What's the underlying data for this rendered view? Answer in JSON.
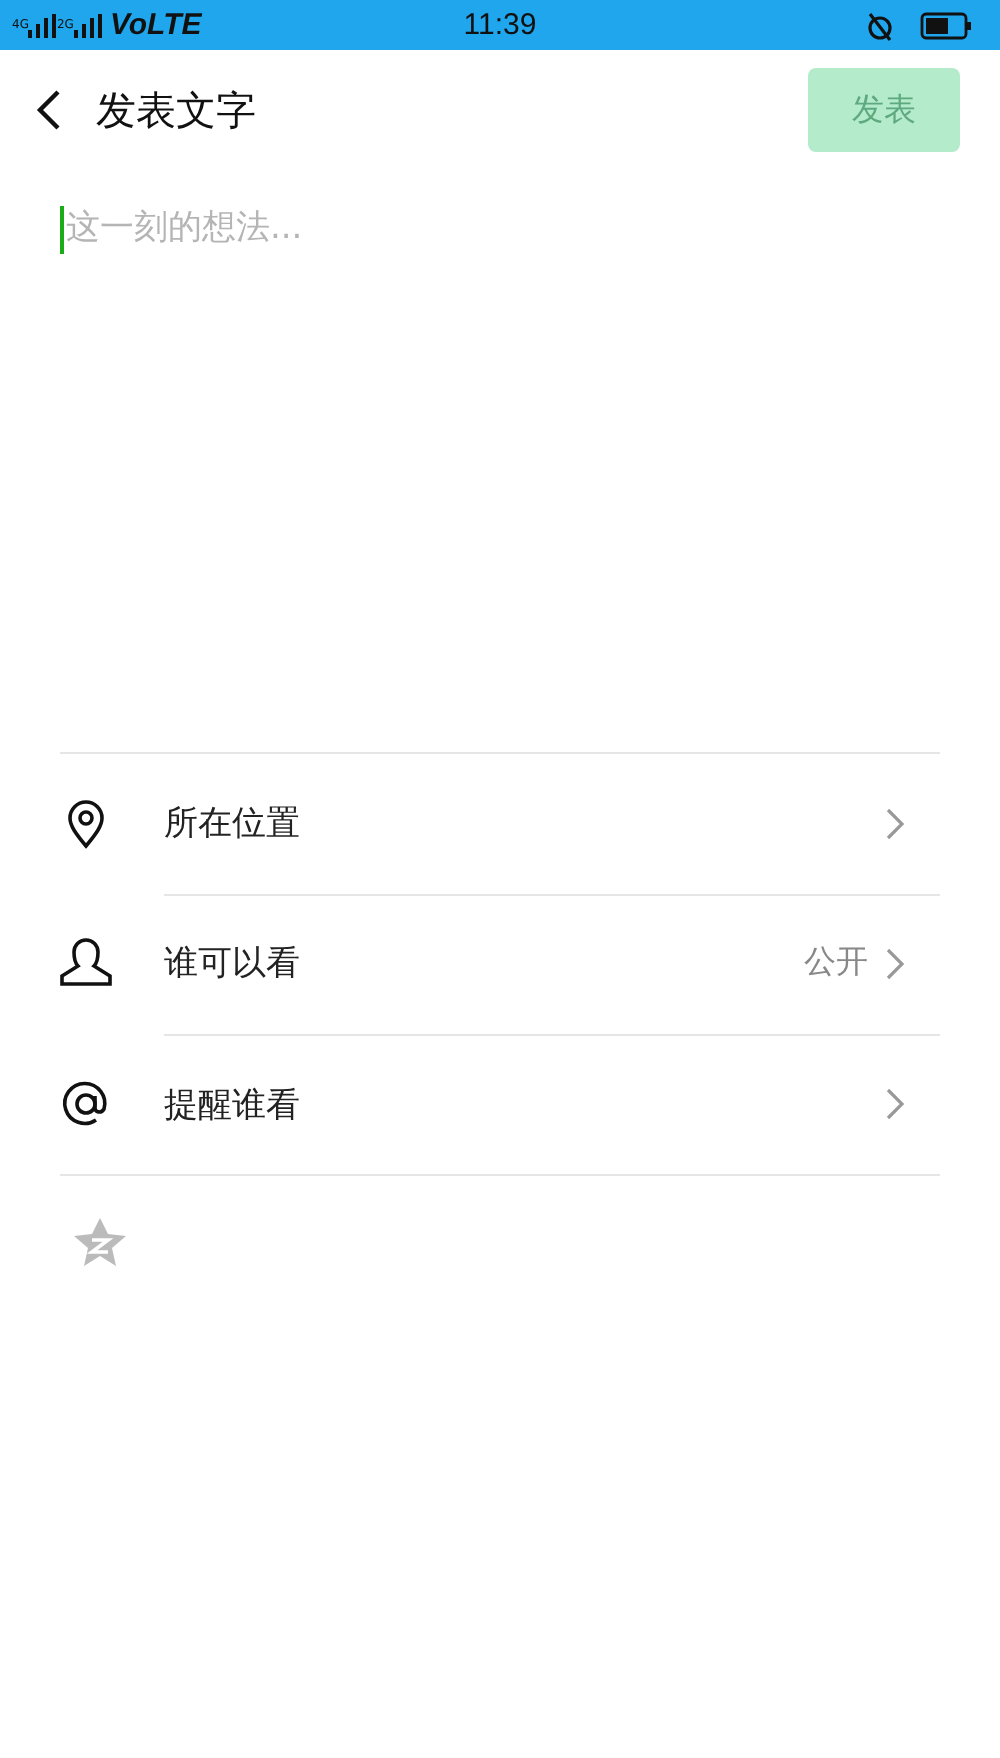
{
  "status_bar": {
    "signal_1": "4G",
    "signal_2": "2G",
    "network": "VoLTE",
    "time": "11:39"
  },
  "header": {
    "title": "发表文字",
    "publish_button": {
      "label": "发表",
      "disabled": true
    }
  },
  "editor": {
    "placeholder": "这一刻的想法..."
  },
  "options": [
    {
      "kind": "location",
      "label": "所在位置"
    },
    {
      "kind": "visibility",
      "label": "谁可以看",
      "value": "公开"
    },
    {
      "kind": "mention",
      "label": "提醒谁看"
    }
  ]
}
